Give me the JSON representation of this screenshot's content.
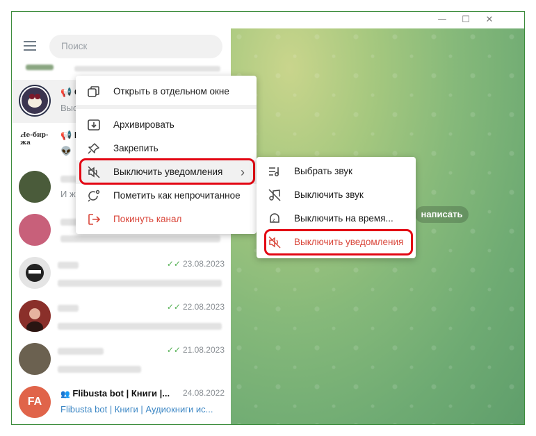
{
  "window": {
    "minimize": "—",
    "maximize": "☐",
    "close": "✕"
  },
  "sidebar": {
    "search_placeholder": "Поиск",
    "chats": [
      {
        "date": "23.08.2023"
      },
      {
        "date": "22.08.2023"
      },
      {
        "date": "21.08.2023"
      },
      {
        "avatar_initials": "FA",
        "title": "Flibusta bot | Книги |...",
        "date": "24.08.2022",
        "preview": "Flibusta bot | Книги | Аудиокниги ис..."
      }
    ],
    "partial_previews": [
      "Выс",
      "И ж"
    ],
    "channel_title_fragment": "С",
    "channel2_title_fragment": "Н",
    "channel2_avatar_text": "Не-бир-жа"
  },
  "chat_area": {
    "write_button": "написать"
  },
  "context_menu": {
    "items": [
      {
        "label": "Открыть в отдельном окне",
        "icon": "open-window-icon"
      },
      {
        "label": "Архивировать",
        "icon": "archive-icon"
      },
      {
        "label": "Закрепить",
        "icon": "pin-icon"
      },
      {
        "label": "Выключить уведомления",
        "icon": "mute-icon",
        "submenu_arrow": "›"
      },
      {
        "label": "Пометить как непрочитанное",
        "icon": "mark-unread-icon"
      },
      {
        "label": "Покинуть канал",
        "icon": "leave-icon"
      }
    ]
  },
  "submenu": {
    "items": [
      {
        "label": "Выбрать звук",
        "icon": "choose-sound-icon"
      },
      {
        "label": "Выключить звук",
        "icon": "sound-off-icon"
      },
      {
        "label": "Выключить на время...",
        "icon": "snooze-icon"
      },
      {
        "label": "Выключить уведомления",
        "icon": "mute-icon"
      }
    ]
  },
  "colors": {
    "accent_red": "#d9463a",
    "highlight": "#e30613",
    "check_green": "#4fae4e",
    "link_blue": "#3b86c4"
  }
}
